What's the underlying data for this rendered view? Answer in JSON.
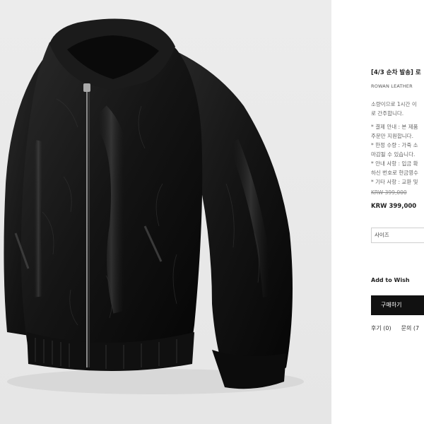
{
  "product": {
    "title": "[4/3 순차 발송] 로",
    "subtitle": "ROWAN LEATHER ",
    "notice_lines": [
      "소량이므로 1시간 이",
      "로 간주합니다.",
      "",
      "* 결제 안내 : 본 제품",
      "주문만 지원합니다.",
      "* 한정 수량 : 가죽 소",
      "마감될 수 있습니다.",
      "* 안내 사항 : 입금 확",
      "하신 번호로 현금영수",
      "* 기타 사항 : 교환 및"
    ],
    "original_price": "KRW 399,000",
    "price": "KRW 399,000"
  },
  "options": {
    "size_selected": "사이즈"
  },
  "actions": {
    "wish_label": "Add to Wish",
    "buy_label": "구매하기"
  },
  "tabs": {
    "review": "후기 (0)",
    "inquiry": "문의 (7"
  },
  "colors": {
    "button_bg": "#111111",
    "image_bg": "#e8e8e8"
  }
}
